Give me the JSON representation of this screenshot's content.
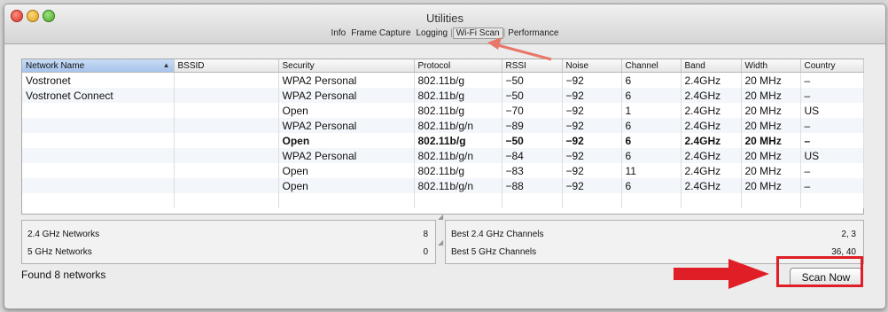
{
  "window": {
    "title": "Utilities",
    "tabs": [
      {
        "label": "Info"
      },
      {
        "label": "Frame Capture"
      },
      {
        "label": "Logging"
      },
      {
        "label": "Wi-Fi Scan"
      },
      {
        "label": "Performance"
      }
    ],
    "active_tab": "Wi-Fi Scan"
  },
  "table": {
    "columns": [
      "Network Name",
      "BSSID",
      "Security",
      "Protocol",
      "RSSI",
      "Noise",
      "Channel",
      "Band",
      "Width",
      "Country"
    ],
    "sorted_column": "Network Name",
    "rows": [
      {
        "name": "Vostronet",
        "bssid": "",
        "security": "WPA2 Personal",
        "protocol": "802.11b/g",
        "rssi": "−50",
        "noise": "−92",
        "channel": "6",
        "band": "2.4GHz",
        "width": "20 MHz",
        "country": "–",
        "bold": false
      },
      {
        "name": "Vostronet Connect",
        "bssid": "",
        "security": "WPA2 Personal",
        "protocol": "802.11b/g",
        "rssi": "−50",
        "noise": "−92",
        "channel": "6",
        "band": "2.4GHz",
        "width": "20 MHz",
        "country": "–",
        "bold": false
      },
      {
        "name": "",
        "bssid": "",
        "security": "Open",
        "protocol": "802.11b/g",
        "rssi": "−70",
        "noise": "−92",
        "channel": "1",
        "band": "2.4GHz",
        "width": "20 MHz",
        "country": "US",
        "bold": false
      },
      {
        "name": "",
        "bssid": "",
        "security": "WPA2 Personal",
        "protocol": "802.11b/g/n",
        "rssi": "−89",
        "noise": "−92",
        "channel": "6",
        "band": "2.4GHz",
        "width": "20 MHz",
        "country": "–",
        "bold": false
      },
      {
        "name": "",
        "bssid": "",
        "security": "Open",
        "protocol": "802.11b/g",
        "rssi": "−50",
        "noise": "−92",
        "channel": "6",
        "band": "2.4GHz",
        "width": "20 MHz",
        "country": "–",
        "bold": true
      },
      {
        "name": "",
        "bssid": "",
        "security": "WPA2 Personal",
        "protocol": "802.11b/g/n",
        "rssi": "−84",
        "noise": "−92",
        "channel": "6",
        "band": "2.4GHz",
        "width": "20 MHz",
        "country": "US",
        "bold": false
      },
      {
        "name": "",
        "bssid": "",
        "security": "Open",
        "protocol": "802.11b/g",
        "rssi": "−83",
        "noise": "−92",
        "channel": "11",
        "band": "2.4GHz",
        "width": "20 MHz",
        "country": "–",
        "bold": false
      },
      {
        "name": "",
        "bssid": "",
        "security": "Open",
        "protocol": "802.11b/g/n",
        "rssi": "−88",
        "noise": "−92",
        "channel": "6",
        "band": "2.4GHz",
        "width": "20 MHz",
        "country": "–",
        "bold": false
      }
    ]
  },
  "summary": {
    "left": [
      {
        "label": "2.4 GHz Networks",
        "value": "8"
      },
      {
        "label": "5 GHz Networks",
        "value": "0"
      }
    ],
    "right": [
      {
        "label": "Best 2.4 GHz Channels",
        "value": "2, 3"
      },
      {
        "label": "Best 5 GHz Channels",
        "value": "36, 40"
      }
    ]
  },
  "status_text": "Found 8 networks",
  "scan_button_label": "Scan Now",
  "colors": {
    "annotation_red": "#e01e26",
    "sorted_header_blue": "#a6c4ec"
  }
}
